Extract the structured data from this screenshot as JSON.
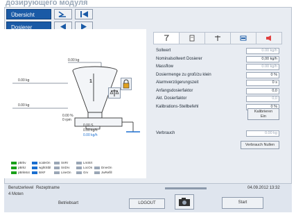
{
  "page_heading": "дозирующего модуля",
  "nav": {
    "overview_tab": "Übersicht",
    "doser_tab": "Dosierer"
  },
  "diagram": {
    "top_weight": "0.00 kg",
    "left_weight_1": "0.00 kg",
    "left_weight_2": "0.00 kg",
    "hopper_number": "1",
    "side_value_1": "0.00 %",
    "side_value_2": "0 rpm",
    "bottom_value_1": "0.00 S",
    "bottom_value_2": "0.00 kg/h",
    "bottom_value_3": "0.00 kg/h"
  },
  "panel": {
    "tabs": [
      "tool-icon",
      "document-icon",
      "scale-icon",
      "monitor-icon",
      "alarm-icon"
    ],
    "rows": [
      {
        "label": "Sollwert",
        "value": "0.00 kg/h",
        "dim": true
      },
      {
        "label": "Nominalsollwert Dosierer",
        "value": "0,00 kg/h",
        "dim": false
      },
      {
        "label": "Massflow",
        "value": "0.00 kg/h",
        "dim": true
      },
      {
        "label": "Dosiermenge zu groß/zu klein",
        "value": "0 %",
        "dim": false
      },
      {
        "label": "Alarmverzögerungszeit",
        "value": "0 s",
        "dim": false
      },
      {
        "label": "Anfangsdosierfaktor",
        "value": "0,0",
        "dim": false
      },
      {
        "label": "Akt. Dosierfaktor",
        "value": "0,0",
        "dim": true
      },
      {
        "label": "Kalibrations-Stellbefehl",
        "value": "0 %",
        "dim": false
      }
    ],
    "calibrate_label": "Kalibrieren",
    "calibrate_sub": "Ein",
    "consumption_label": "Verbrauch",
    "consumption_value": "0.00 kg",
    "reset_consumption_label": "Verbrauch Nullen"
  },
  "legend": [
    {
      "label": "pBrkv",
      "color": "#1aa01a"
    },
    {
      "label": "scaleOn",
      "color": "#1a6fd0"
    },
    {
      "label": "SnRr",
      "color": "#9aa6b6"
    },
    {
      "label": "LmStrt",
      "color": "#9aa6b6"
    },
    {
      "label": "pBrkz",
      "color": "#1aa01a"
    },
    {
      "label": "wghtStbl",
      "color": "#1a6fd0"
    },
    {
      "label": "SnDrv",
      "color": "#9aa6b6"
    },
    {
      "label": "LocOn",
      "color": "#9aa6b6"
    },
    {
      "label": "DrveOn",
      "color": "#9aa6b6"
    },
    {
      "label": "pBrkMot",
      "color": "#1aa01a"
    },
    {
      "label": "BrkF",
      "color": "#1a6fd0"
    },
    {
      "label": "LineOn",
      "color": "#9aa6b6"
    },
    {
      "label": "Grv",
      "color": "#9aa6b6"
    },
    {
      "label": "JwRefill",
      "color": "#9aa6b6"
    }
  ],
  "footer": {
    "user_level_label": "Benutzerlevel",
    "user_level_value": "4 Moten",
    "recipe_label": "Rezeptname",
    "mode_label": "Betriebsart",
    "datetime": "04.09.2012 13:32",
    "logout_label": "LOGOUT",
    "start_label": "Start"
  }
}
